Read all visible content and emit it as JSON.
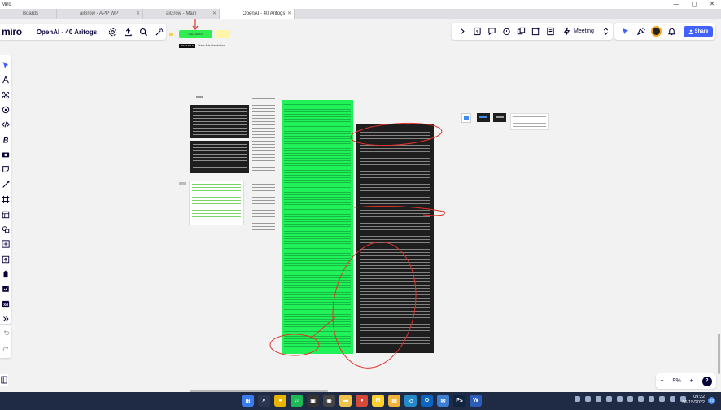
{
  "window": {
    "app_title": "Miro",
    "controls": [
      "—",
      "▢",
      "✕"
    ]
  },
  "tabs": [
    {
      "label": "Boards",
      "active": false
    },
    {
      "label": "aiGrow - APP WP",
      "active": false
    },
    {
      "label": "aiGrow - Main",
      "active": false
    },
    {
      "label": "OpenAI - 40 Aritogs",
      "active": true
    }
  ],
  "toolbar": {
    "logo": "miro",
    "board_name": "OpenAI - 40 Aritogs",
    "meeting_label": "Meeting",
    "share_label": "Share"
  },
  "board": {
    "sticky_green_text": "CALLBACK",
    "black_label": "WALKABLE",
    "small_label": "Team Ads Breakdown"
  },
  "zoom": {
    "minus": "−",
    "level": "9%",
    "plus": "+",
    "help": "?"
  },
  "taskbar": {
    "apps": [
      {
        "name": "windows-start",
        "color": "#3a7cf0",
        "glyph": "⊞"
      },
      {
        "name": "search",
        "color": "#2b3552",
        "glyph": "⌕"
      },
      {
        "name": "chrome",
        "color": "#e8b400",
        "glyph": "●"
      },
      {
        "name": "spotify",
        "color": "#1db954",
        "glyph": "♫"
      },
      {
        "name": "media",
        "color": "#333333",
        "glyph": "▣"
      },
      {
        "name": "github",
        "color": "#444444",
        "glyph": "◉"
      },
      {
        "name": "folder",
        "color": "#f1c24b",
        "glyph": "▬"
      },
      {
        "name": "chrome-2",
        "color": "#d84a38",
        "glyph": "●"
      },
      {
        "name": "miro",
        "color": "#ffd02f",
        "glyph": "M"
      },
      {
        "name": "explorer",
        "color": "#f0b43a",
        "glyph": "▤"
      },
      {
        "name": "vscode",
        "color": "#2489ca",
        "glyph": "◁"
      },
      {
        "name": "outlook",
        "color": "#0a64c2",
        "glyph": "O"
      },
      {
        "name": "mail",
        "color": "#3b7fd4",
        "glyph": "✉"
      },
      {
        "name": "photoshop",
        "color": "#0e2440",
        "glyph": "Ps"
      },
      {
        "name": "word",
        "color": "#2b5cb8",
        "glyph": "W"
      }
    ],
    "time": "09:22",
    "date": "06/15/2022",
    "notifications": "22"
  }
}
